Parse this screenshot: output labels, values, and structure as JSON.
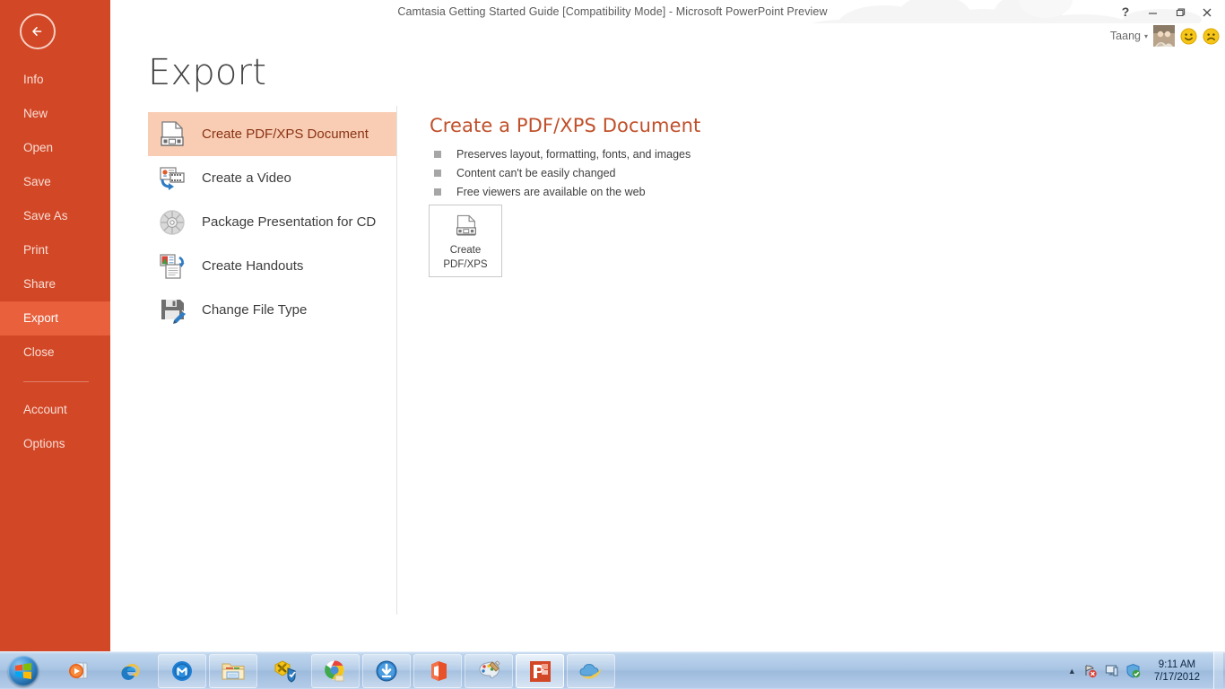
{
  "window": {
    "title": "Camtasia Getting Started Guide [Compatibility Mode] - Microsoft PowerPoint Preview",
    "help_label": "?",
    "minimize_label": "minimize-icon",
    "restore_label": "restore-icon",
    "close_label": "close-icon",
    "accent_color": "#d24726"
  },
  "account": {
    "name": "Taang",
    "caret": "▾",
    "avatar_name": "user-avatar",
    "smile_feedback": "smiley-face-icon",
    "frown_feedback": "frowny-face-icon"
  },
  "backstage": {
    "back_label": "back-arrow-icon",
    "page_title": "Export",
    "nav": [
      {
        "label": "Info",
        "active": false
      },
      {
        "label": "New",
        "active": false
      },
      {
        "label": "Open",
        "active": false
      },
      {
        "label": "Save",
        "active": false
      },
      {
        "label": "Save As",
        "active": false
      },
      {
        "label": "Print",
        "active": false
      },
      {
        "label": "Share",
        "active": false
      },
      {
        "label": "Export",
        "active": true
      },
      {
        "label": "Close",
        "active": false
      }
    ],
    "nav_bottom": [
      {
        "label": "Account",
        "active": false
      },
      {
        "label": "Options",
        "active": false
      }
    ],
    "options": [
      {
        "label": "Create PDF/XPS Document",
        "icon": "pdf-document-icon",
        "active": true
      },
      {
        "label": "Create a Video",
        "icon": "video-icon",
        "active": false
      },
      {
        "label": "Package Presentation for CD",
        "icon": "cd-disc-icon",
        "active": false
      },
      {
        "label": "Create Handouts",
        "icon": "handouts-icon",
        "active": false
      },
      {
        "label": "Change File Type",
        "icon": "save-disk-icon",
        "active": false
      }
    ],
    "detail": {
      "heading": "Create a PDF/XPS Document",
      "heading_color": "#c0502a",
      "bullets": [
        "Preserves layout, formatting, fonts, and images",
        "Content can't be easily changed",
        "Free viewers are available on the web"
      ],
      "action_button": {
        "line1": "Create",
        "line2": "PDF/XPS",
        "icon": "pdf-document-icon"
      }
    }
  },
  "taskbar": {
    "start_label": "windows-start-orb",
    "buttons": [
      {
        "name": "media-player-icon",
        "pinned": true,
        "active": false
      },
      {
        "name": "internet-explorer-icon",
        "pinned": true,
        "active": false
      },
      {
        "name": "maxthon-browser-icon",
        "pinned": false,
        "active": false
      },
      {
        "name": "file-explorer-icon",
        "pinned": false,
        "active": false
      },
      {
        "name": "security-tools-icon",
        "pinned": true,
        "active": false
      },
      {
        "name": "google-chrome-icon",
        "pinned": false,
        "active": false
      },
      {
        "name": "download-manager-icon",
        "pinned": false,
        "active": false
      },
      {
        "name": "microsoft-office-icon",
        "pinned": false,
        "active": false
      },
      {
        "name": "paint-icon",
        "pinned": false,
        "active": false
      },
      {
        "name": "powerpoint-icon",
        "pinned": false,
        "active": true
      },
      {
        "name": "skydrive-icon",
        "pinned": false,
        "active": false
      }
    ],
    "tray": {
      "overflow_arrow": "▲",
      "icons": [
        "network-error-icon",
        "display-icon",
        "safety-shield-icon"
      ],
      "time": "9:11 AM",
      "date": "7/17/2012"
    }
  }
}
